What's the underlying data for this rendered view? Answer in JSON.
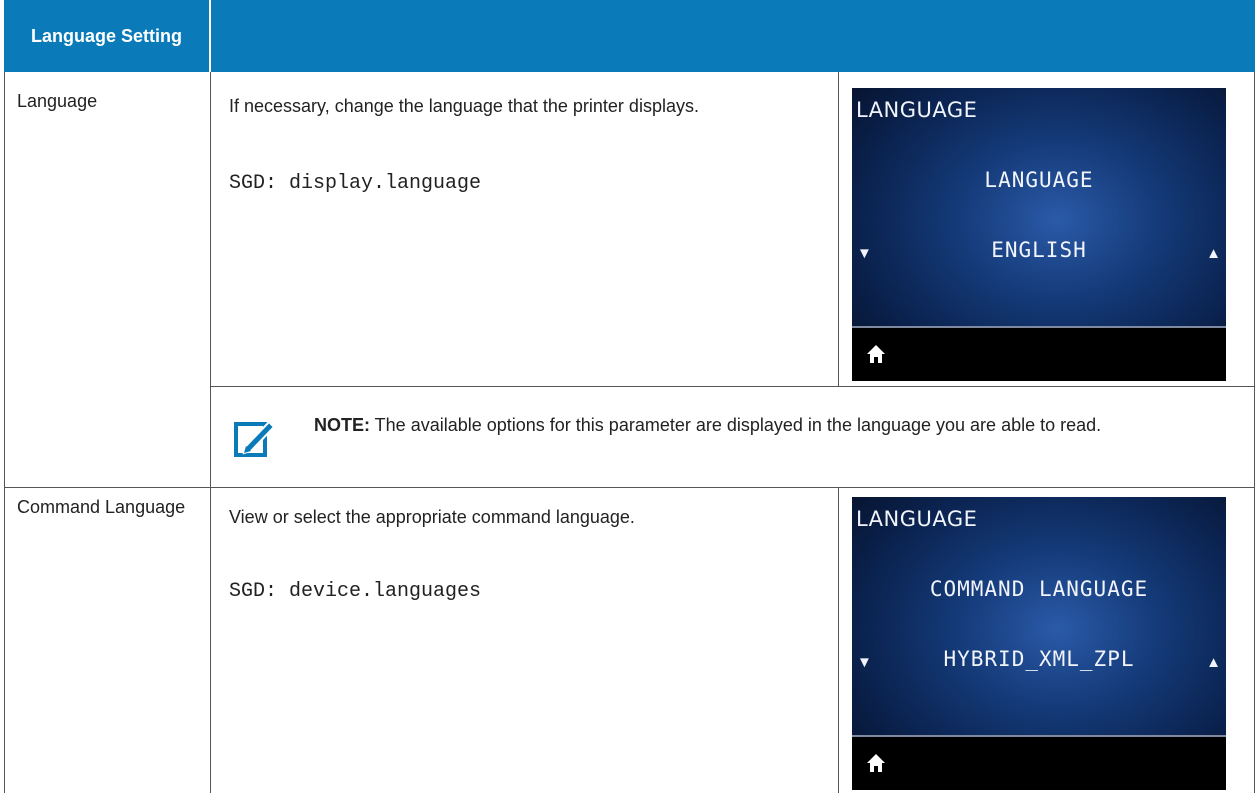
{
  "table": {
    "header": {
      "col1": "Language Setting",
      "col2": ""
    },
    "rows": [
      {
        "label": "Language",
        "description": "If necessary, change the language that the printer displays.",
        "sgd": "SGD: display.language",
        "screen": {
          "title": "LANGUAGE",
          "item": "LANGUAGE",
          "value": "ENGLISH",
          "left_arrow": "▼",
          "right_arrow": "▲",
          "home_icon": "home-icon"
        },
        "note": {
          "icon": "note-pencil-icon",
          "label": "NOTE:",
          "text": " The available options for this parameter are displayed in the language you are able to read."
        }
      },
      {
        "label": "Command Language",
        "description": "View or select the appropriate command language.",
        "sgd": "SGD: device.languages",
        "screen": {
          "title": "LANGUAGE",
          "item": "COMMAND LANGUAGE",
          "value": "HYBRID_XML_ZPL",
          "left_arrow": "▼",
          "right_arrow": "▲",
          "home_icon": "home-icon"
        }
      }
    ]
  },
  "colors": {
    "header_bg": "#0a7ab8",
    "note_icon": "#0a7ab8"
  }
}
